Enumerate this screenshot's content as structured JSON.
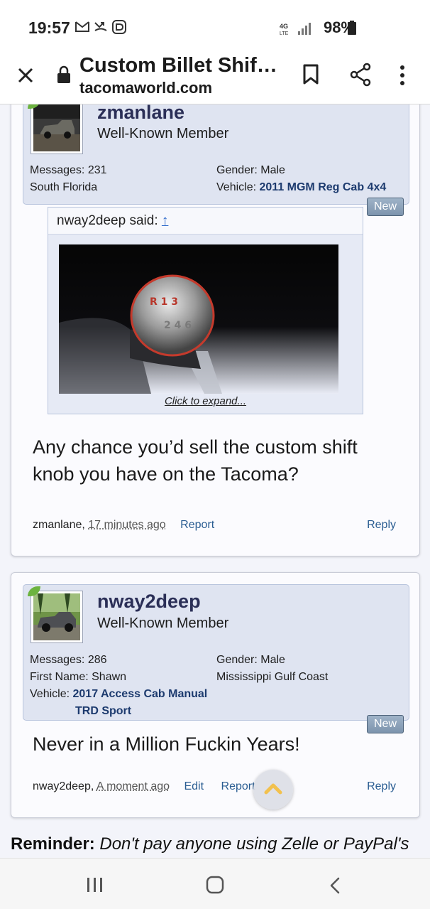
{
  "status_bar": {
    "time": "19:57",
    "network": "4G LTE",
    "battery": "98%"
  },
  "header": {
    "title": "Custom Billet Shif…",
    "domain": "tacomaworld.com"
  },
  "posts": [
    {
      "username": "zmanlane",
      "user_title": "Well-Known Member",
      "messages_label": "Messages:",
      "messages": "231",
      "location": "South Florida",
      "gender_label": "Gender:",
      "gender": "Male",
      "vehicle_label": "Vehicle:",
      "vehicle": "2011 MGM Reg Cab 4x4",
      "badge": "New",
      "quote": {
        "author": "nway2deep said:",
        "arrow": "↑",
        "expand": "Click to expand..."
      },
      "message": "Any chance you’d sell the custom shift knob you have on the Tacoma?",
      "footer_author": "zmanlane,",
      "footer_time": "17 minutes ago",
      "report": "Report",
      "reply": "Reply"
    },
    {
      "username": "nway2deep",
      "user_title": "Well-Known Member",
      "messages_label": "Messages:",
      "messages": "286",
      "first_name_label": "First Name:",
      "first_name": "Shawn",
      "gender_label": "Gender:",
      "gender": "Male",
      "location": "Mississippi Gulf Coast",
      "vehicle_label": "Vehicle:",
      "vehicle_line1": "2017 Access Cab Manual",
      "vehicle_line2": "TRD Sport",
      "badge": "New",
      "message": "Never in a Million Fuckin Years!",
      "footer_author": "nway2deep,",
      "footer_time": "A moment ago",
      "edit": "Edit",
      "report": "Report",
      "reply": "Reply"
    }
  ],
  "reminder": {
    "label": "Reminder:",
    "text": "Don't pay anyone using Zelle or PayPal's"
  },
  "colors": {
    "userbox_bg": "#dfe4f1",
    "username": "#2b2f57",
    "link": "#2a5d92",
    "badge": "#8aa0b8"
  }
}
